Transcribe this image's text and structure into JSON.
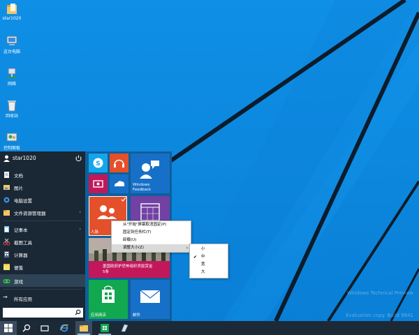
{
  "desktop": {
    "icons": [
      {
        "name": "folder-icon",
        "label": "star1020"
      },
      {
        "name": "computer-icon",
        "label": "这台电脑"
      },
      {
        "name": "network-icon",
        "label": "网络"
      },
      {
        "name": "recycle-bin-icon",
        "label": "回收站"
      },
      {
        "name": "control-panel-icon",
        "label": "控制面板"
      }
    ],
    "watermark_lines": [
      "Windows Technical Preview",
      "Evaluation copy. Build 9841"
    ]
  },
  "start_menu": {
    "user_name": "star1020",
    "items": [
      {
        "label": "文档",
        "icon": "document-icon",
        "arrow": ""
      },
      {
        "label": "图片",
        "icon": "pictures-icon",
        "arrow": ""
      },
      {
        "label": "电脑设置",
        "icon": "settings-icon",
        "arrow": ""
      },
      {
        "label": "文件资源管理器",
        "icon": "file-explorer-icon",
        "arrow": "›"
      },
      {
        "label": "记事本",
        "icon": "notepad-icon",
        "arrow": "›"
      },
      {
        "label": "截图工具",
        "icon": "snipping-tool-icon",
        "arrow": ""
      },
      {
        "label": "计算器",
        "icon": "calculator-icon",
        "arrow": ""
      },
      {
        "label": "便笺",
        "icon": "sticky-notes-icon",
        "arrow": ""
      },
      {
        "label": "游戏",
        "icon": "games-icon",
        "arrow": ""
      }
    ],
    "all_apps": "所有应用",
    "all_apps_arrow": "→",
    "search_placeholder": ""
  },
  "tiles": {
    "windows_feedback": "Windows\nFeedback",
    "people": "人脉",
    "news_headline": "墨国政府护恐怖组织奖励赏金",
    "news_extra": "5条",
    "store": "应用商店",
    "mail": "邮件"
  },
  "context_menu": {
    "items": [
      "从\"开始\"屏幕取消固定(P)",
      "固定到任务栏(T)",
      "卸载(U)",
      "调整大小(Z)"
    ],
    "selected_index": 3,
    "submenu_arrow": "›"
  },
  "resize_submenu": {
    "items": [
      "小",
      "中",
      "宽",
      "大"
    ],
    "checked_index": 1,
    "check_mark": "✔"
  },
  "colors": {
    "desktop_blue": "#0b86dc",
    "start_left": "#1a2735",
    "start_right": "#0f5f9b",
    "tile_red": "#e4502a",
    "tile_purple": "#7141a3",
    "tile_green": "#11a84f",
    "tile_blue": "#1770c8",
    "tile_skype": "#14a6ec",
    "tile_teal": "#c2185b"
  }
}
